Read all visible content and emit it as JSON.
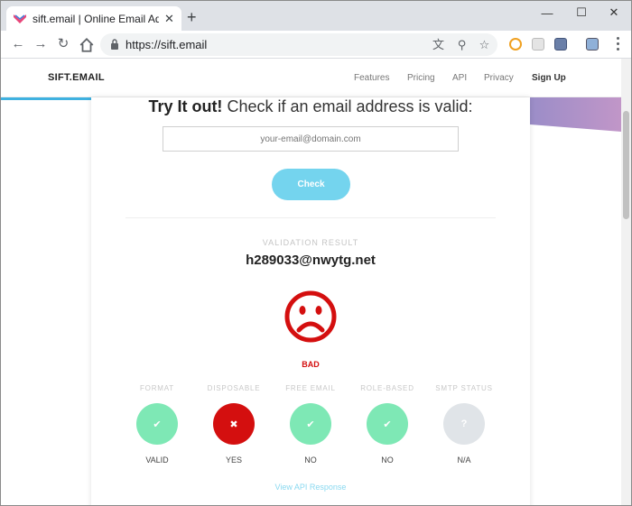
{
  "browser": {
    "tab_title": "sift.email | Online Email Address",
    "url": "https://sift.email"
  },
  "header": {
    "brand": "SIFT.EMAIL",
    "nav": [
      "Features",
      "Pricing",
      "API",
      "Privacy",
      "Sign Up"
    ]
  },
  "hero": {
    "title_bold": "Try It out!",
    "title_rest": " Check if an email address is valid:",
    "input_placeholder": "your-email@domain.com",
    "check_label": "Check"
  },
  "result": {
    "label": "VALIDATION RESULT",
    "email": "h289033@nwytg.net",
    "verdict": "BAD",
    "verdict_color": "#d40f0f",
    "checks": [
      {
        "label": "FORMAT",
        "icon": "check-icon",
        "color": "#7ee8b5",
        "value": "VALID"
      },
      {
        "label": "DISPOSABLE",
        "icon": "cross-icon",
        "color": "#d40f0f",
        "value": "YES"
      },
      {
        "label": "FREE EMAIL",
        "icon": "check-icon",
        "color": "#7ee8b5",
        "value": "NO"
      },
      {
        "label": "ROLE-BASED",
        "icon": "check-icon",
        "color": "#7ee8b5",
        "value": "NO"
      },
      {
        "label": "SMTP STATUS",
        "icon": "question-icon",
        "color": "#e0e4e8",
        "value": "N/A"
      }
    ],
    "api_link": "View API Response"
  }
}
